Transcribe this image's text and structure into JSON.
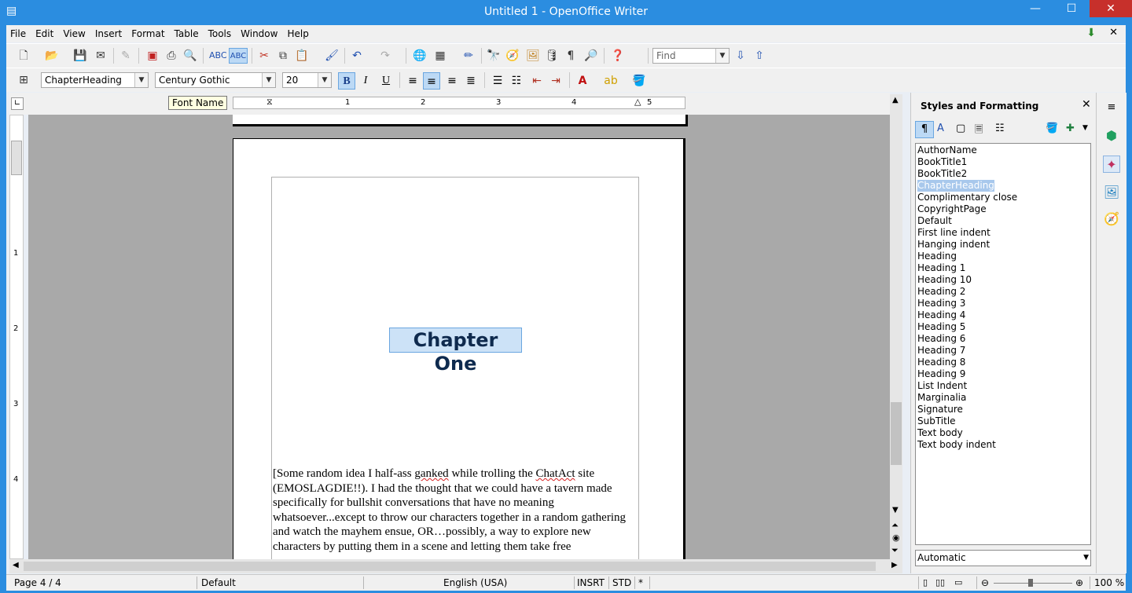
{
  "window": {
    "title": "Untitled 1 - OpenOffice Writer",
    "minimize": "—",
    "maximize": "☐",
    "close": "✕"
  },
  "menu": [
    "File",
    "Edit",
    "View",
    "Insert",
    "Format",
    "Table",
    "Tools",
    "Window",
    "Help"
  ],
  "toolbar": {
    "find_placeholder": "Find"
  },
  "formatting": {
    "paragraph_style": "ChapterHeading",
    "font_name": "Century Gothic",
    "font_size": "20",
    "bold_label": "B",
    "italic_label": "I",
    "underline_label": "U"
  },
  "tooltip": "Font Name",
  "ruler": {
    "marks": [
      "1",
      "2",
      "3",
      "4",
      "5"
    ],
    "vmarks": [
      "1",
      "2",
      "3",
      "4"
    ]
  },
  "document": {
    "heading": "Chapter One",
    "body_parts": [
      "[Some random idea I half-ass ",
      "ganked",
      " while trolling the ",
      "ChatAct",
      " site (EMOSLAGDIE!!). I had the thought that we could have a tavern made specifically for bullshit conversations that have no meaning whatsoever...except to throw our characters together in a random gathering and watch the mayhem ensue, OR…possibly, a way to explore new characters by putting them in a scene and letting them take free"
    ]
  },
  "sidebar": {
    "title": "Styles and Formatting",
    "styles": [
      "AuthorName",
      "BookTitle1",
      "BookTitle2",
      "ChapterHeading",
      "Complimentary close",
      "CopyrightPage",
      "Default",
      "First line indent",
      "Hanging indent",
      "Heading",
      "Heading 1",
      "Heading 10",
      "Heading 2",
      "Heading 3",
      "Heading 4",
      "Heading 5",
      "Heading 6",
      "Heading 7",
      "Heading 8",
      "Heading 9",
      "List Indent",
      "Marginalia",
      "Signature",
      "SubTitle",
      "Text body",
      "Text body indent"
    ],
    "selected": "ChapterHeading",
    "filter": "Automatic"
  },
  "status": {
    "page": "Page 4 / 4",
    "page_style": "Default",
    "language": "English (USA)",
    "insert_mode": "INSRT",
    "selection_mode": "STD",
    "modified": "*",
    "zoom": "100 %"
  },
  "colors": {
    "titlebar": "#2b8de0",
    "close_button": "#c7302b",
    "selection": "#cce2f7"
  }
}
